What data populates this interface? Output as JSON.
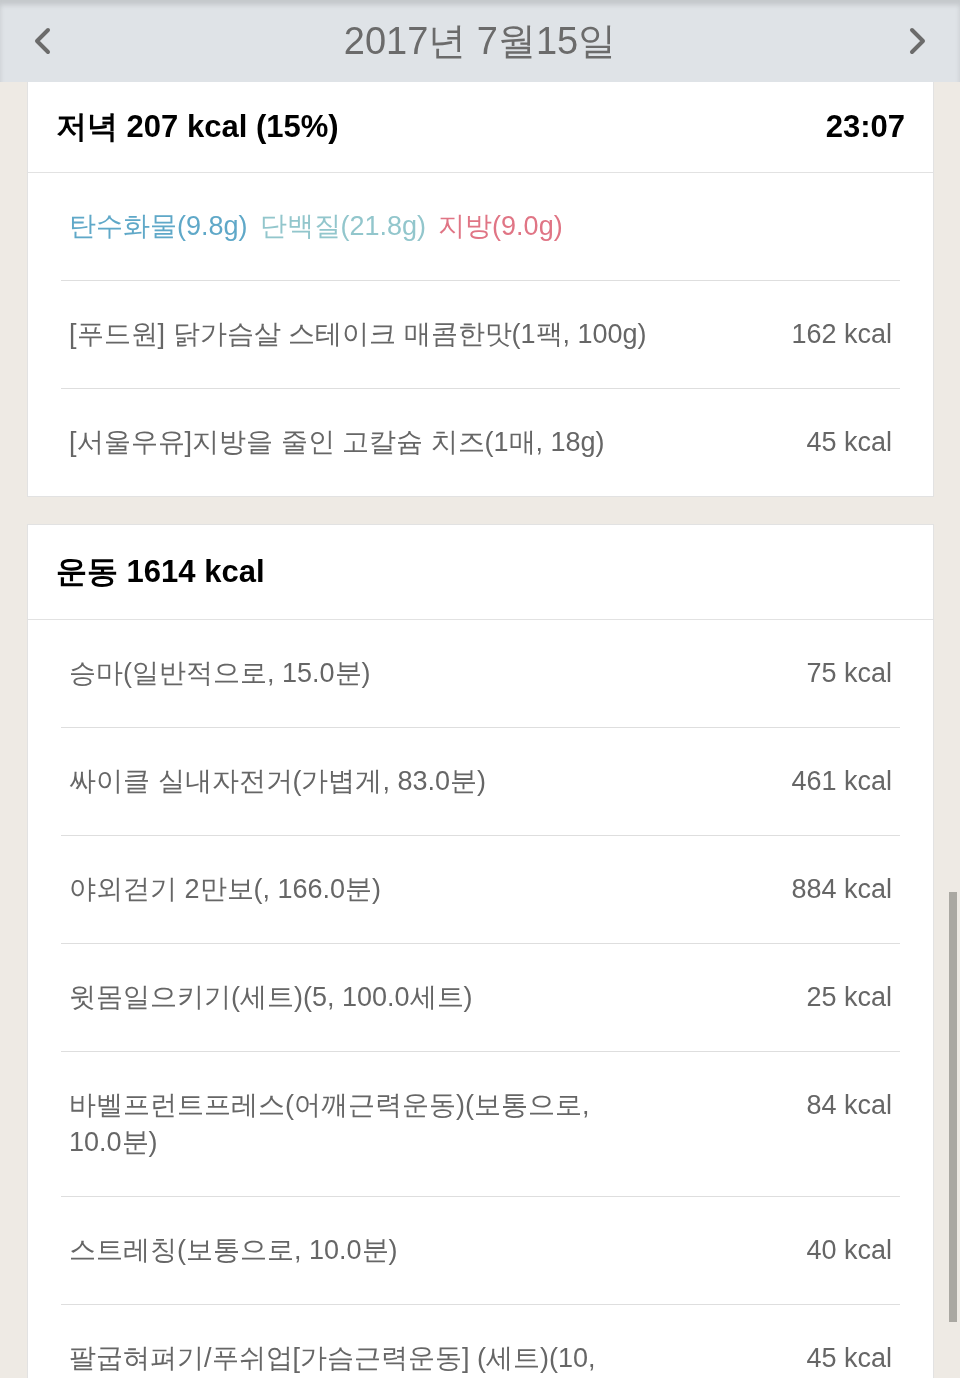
{
  "header": {
    "title": "2017년 7월15일"
  },
  "meal": {
    "title": "저녁 207 kcal (15%)",
    "time": "23:07",
    "macros": [
      {
        "label": "탄수화물(9.8g)",
        "color": "#5fa8c8"
      },
      {
        "label": "단백질(21.8g)",
        "color": "#92c6cc"
      },
      {
        "label": "지방(9.0g)",
        "color": "#e07585"
      }
    ],
    "items": [
      {
        "name": "[푸드원] 닭가슴살 스테이크 매콤한맛(1팩, 100g)",
        "kcal": "162 kcal"
      },
      {
        "name": "[서울우유]지방을 줄인 고칼슘 치즈(1매, 18g)",
        "kcal": "45 kcal"
      }
    ]
  },
  "exercise": {
    "title": "운동 1614 kcal",
    "items": [
      {
        "name": "승마(일반적으로, 15.0분)",
        "kcal": "75 kcal"
      },
      {
        "name": "싸이클 실내자전거(가볍게, 83.0분)",
        "kcal": "461 kcal"
      },
      {
        "name": "야외걷기 2만보(, 166.0분)",
        "kcal": "884 kcal"
      },
      {
        "name": "윗몸일으키기(세트)(5, 100.0세트)",
        "kcal": "25 kcal"
      },
      {
        "name": "바벨프런트프레스(어깨근력운동)(보통으로, 10.0분)",
        "kcal": "84 kcal"
      },
      {
        "name": "스트레칭(보통으로, 10.0분)",
        "kcal": "40 kcal"
      },
      {
        "name": "팔굽혀펴기/푸쉬업[가슴근력운동] (세트)(10,",
        "kcal": "45 kcal"
      }
    ]
  }
}
